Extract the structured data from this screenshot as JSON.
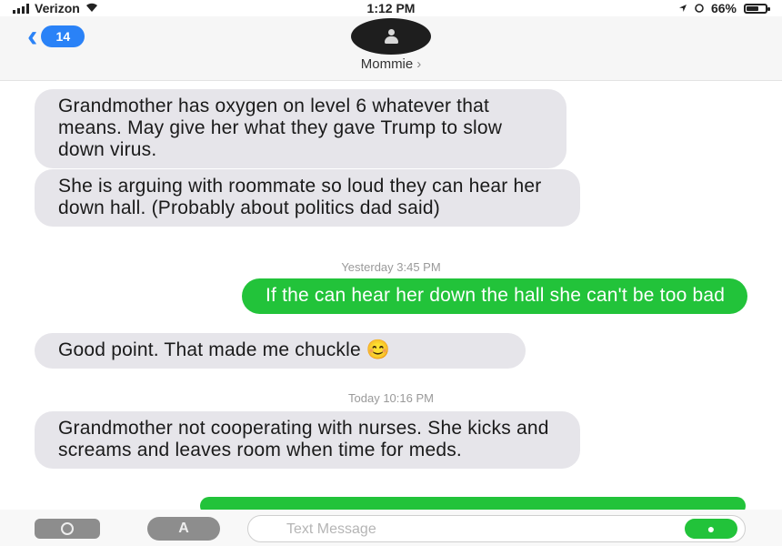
{
  "status_bar": {
    "carrier": "Verizon",
    "time": "1:12 PM",
    "battery": "66%",
    "battery_level": 0.66
  },
  "header": {
    "back_badge": "14",
    "contact_name": "Mommie",
    "contact_chevron": "›"
  },
  "messages": [
    {
      "dir": "in",
      "text": "Grandmother has oxygen on level 6 whatever that means. May give her what they gave Trump to slow down virus."
    },
    {
      "dir": "in",
      "text": "She is arguing with roommate so loud they can hear her down hall. (Probably about politics dad said)"
    },
    {
      "dir": "time",
      "text": "Yesterday 3:45 PM"
    },
    {
      "dir": "out",
      "text": "If the can hear her down the hall she can't be too bad"
    },
    {
      "dir": "in",
      "text": "Good point. That made me chuckle 😊"
    },
    {
      "dir": "time",
      "text": "Today 10:16 PM"
    },
    {
      "dir": "in",
      "text": "Grandmother not cooperating with nurses. She kicks and screams and leaves room when time for meds."
    },
    {
      "dir": "out",
      "text": ""
    }
  ],
  "composer": {
    "placeholder": "Text Message",
    "apps_label": "A",
    "mic_label": "●"
  }
}
